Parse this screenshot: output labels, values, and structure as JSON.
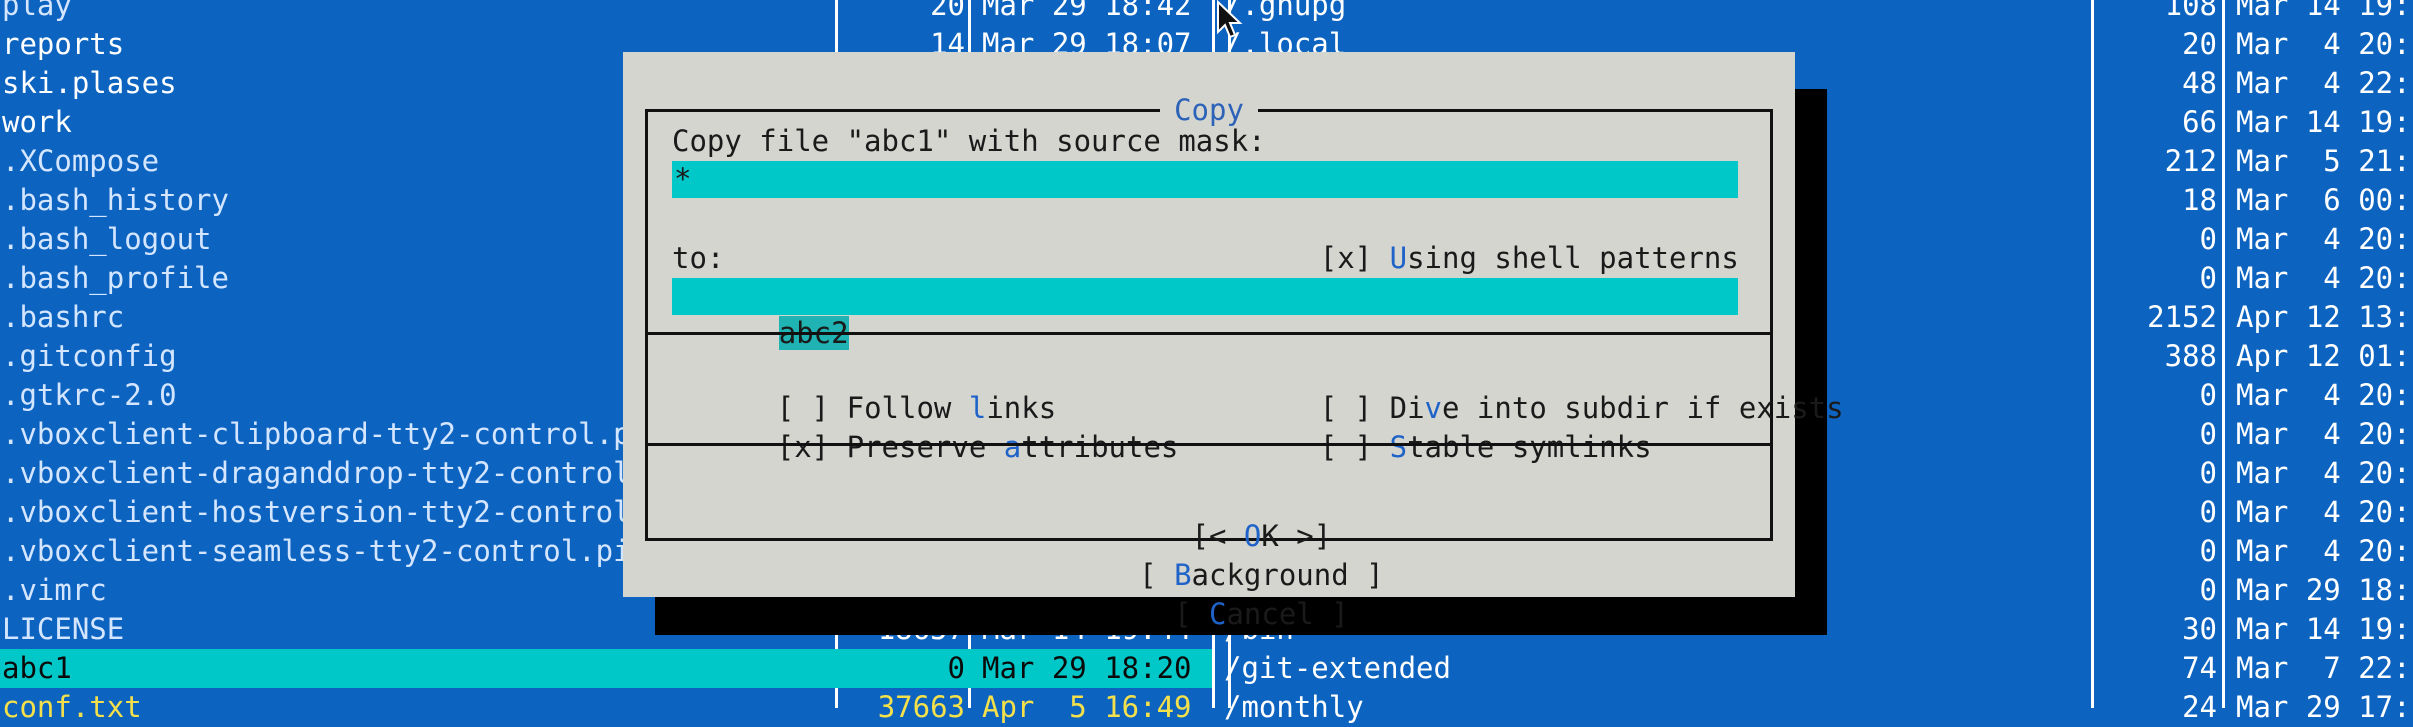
{
  "left_panel": {
    "rows": [
      {
        "name": "play",
        "size": "20",
        "date": "Mar 29 18:42",
        "style": "dim"
      },
      {
        "name": "reports",
        "size": "14",
        "date": "Mar 29 18:07",
        "style": ""
      },
      {
        "name": "ski.plases",
        "size": "",
        "date": "",
        "style": ""
      },
      {
        "name": "work",
        "size": "",
        "date": "",
        "style": ""
      },
      {
        "name": ".XCompose",
        "size": "",
        "date": "",
        "style": "dim"
      },
      {
        "name": ".bash_history",
        "size": "",
        "date": "",
        "style": "dim"
      },
      {
        "name": ".bash_logout",
        "size": "",
        "date": "",
        "style": "dim"
      },
      {
        "name": ".bash_profile",
        "size": "",
        "date": "",
        "style": "dim"
      },
      {
        "name": ".bashrc",
        "size": "",
        "date": "",
        "style": "dim"
      },
      {
        "name": ".gitconfig",
        "size": "",
        "date": "",
        "style": "dim"
      },
      {
        "name": ".gtkrc-2.0",
        "size": "",
        "date": "",
        "style": "dim"
      },
      {
        "name": ".vboxclient-clipboard-tty2-control.p",
        "size": "",
        "date": "",
        "style": "dim"
      },
      {
        "name": ".vboxclient-draganddrop-tty2-control",
        "size": "",
        "date": "",
        "style": "dim"
      },
      {
        "name": ".vboxclient-hostversion-tty2-control",
        "size": "",
        "date": "",
        "style": "dim"
      },
      {
        "name": ".vboxclient-seamless-tty2-control.pi",
        "size": "",
        "date": "",
        "style": "dim"
      },
      {
        "name": ".vimrc",
        "size": "",
        "date": "",
        "style": "dim"
      },
      {
        "name": "LICENSE",
        "size": "18657",
        "date": "Mar 14 19:44",
        "style": "dim"
      },
      {
        "name": "abc1",
        "size": "0",
        "date": "Mar 29 18:20",
        "style": "sel"
      },
      {
        "name": "conf.txt",
        "size": "37663",
        "date": "Apr  5 16:49",
        "style": "exe"
      }
    ]
  },
  "right_panel": {
    "rows": [
      {
        "name": "/.gnupg",
        "size": "108",
        "date": "Mar 14 19:"
      },
      {
        "name": "/.local",
        "size": "20",
        "date": "Mar  4 20:"
      },
      {
        "name": "",
        "size": "48",
        "date": "Mar  4 22:"
      },
      {
        "name": "",
        "size": "66",
        "date": "Mar 14 19:"
      },
      {
        "name": "",
        "size": "212",
        "date": "Mar  5 21:"
      },
      {
        "name": "",
        "size": "18",
        "date": "Mar  6 00:"
      },
      {
        "name": "",
        "size": "0",
        "date": "Mar  4 20:"
      },
      {
        "name": "",
        "size": "0",
        "date": "Mar  4 20:"
      },
      {
        "name": "",
        "size": "2152",
        "date": "Apr 12 13:"
      },
      {
        "name": "",
        "size": "388",
        "date": "Apr 12 01:"
      },
      {
        "name": "",
        "size": "0",
        "date": "Mar  4 20:"
      },
      {
        "name": "",
        "size": "0",
        "date": "Mar  4 20:"
      },
      {
        "name": "",
        "size": "0",
        "date": "Mar  4 20:"
      },
      {
        "name": "",
        "size": "0",
        "date": "Mar  4 20:"
      },
      {
        "name": "",
        "size": "0",
        "date": "Mar  4 20:"
      },
      {
        "name": "",
        "size": "0",
        "date": "Mar 29 18:"
      },
      {
        "name": "/bin",
        "size": "30",
        "date": "Mar 14 19:"
      },
      {
        "name": "/git-extended",
        "size": "74",
        "date": "Mar  7 22:"
      },
      {
        "name": "/monthly",
        "size": "24",
        "date": "Mar 29 17:"
      }
    ]
  },
  "dialog": {
    "title": "Copy",
    "source_label": "Copy file \"abc1\" with source mask:",
    "source_mask": "*",
    "shell_patterns": {
      "mark": "[x]",
      "pre": " ",
      "hot": "U",
      "post": "sing shell patterns"
    },
    "to_label": "to:",
    "destination": "abc2",
    "follow_links": {
      "mark": "[ ]",
      "pre": " Follow ",
      "hot": "l",
      "post": "inks"
    },
    "preserve_attributes": {
      "mark": "[x]",
      "pre": " Preserve ",
      "hot": "a",
      "post": "ttributes"
    },
    "dive_subdir": {
      "mark": "[ ]",
      "pre": " Di",
      "hot": "v",
      "post": "e into subdir if exists"
    },
    "stable_symlinks": {
      "mark": "[ ]",
      "pre": " ",
      "hot": "S",
      "post": "table symlinks"
    },
    "ok_button": {
      "pre": "[< ",
      "hot": "O",
      "post": "K >]"
    },
    "background_button": {
      "pre": "[ ",
      "hot": "B",
      "post": "ackground ]"
    },
    "cancel_button": {
      "pre": "[ ",
      "hot": "C",
      "post": "ancel ]"
    }
  },
  "colors": {
    "panel_bg": "#0c63c0",
    "selection": "#00c8c8",
    "dialog_bg": "#d5d5d0",
    "hotkey": "#1f63c8",
    "executable": "#f4e04a"
  }
}
